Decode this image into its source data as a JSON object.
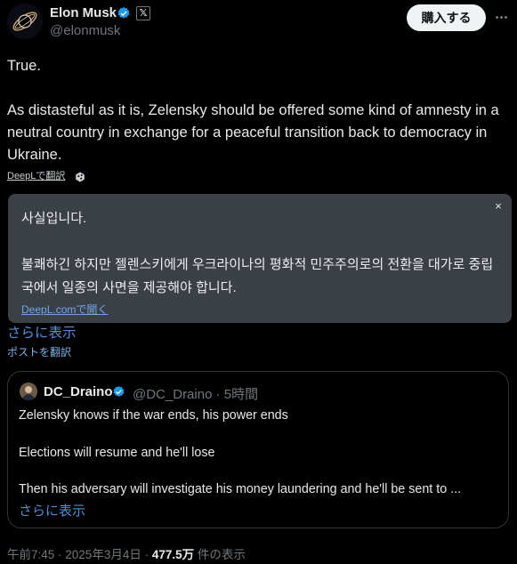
{
  "author": {
    "name": "Elon Musk",
    "handle": "@elonmusk",
    "x_badge": "𝕏"
  },
  "subscribe_button": "購入する",
  "tweet": {
    "text": "True.\n\nAs distasteful as it is, Zelensky should be offered some kind of amnesty in a neutral country in exchange for a peaceful transition back to democracy in Ukraine."
  },
  "deepl": {
    "label": "DeepLで翻訳",
    "translation": "사실입니다.\n\n불쾌하긴 하지만 젤렌스키에게 우크라이나의 평화적 민주주의로의 전환을 대가로 중립국에서 일종의 사면을 제공해야 합니다.",
    "open_link": "DeepL.comで開く",
    "close": "×"
  },
  "show_more": "さらに表示",
  "translate_post": "ポストを翻訳",
  "quote": {
    "name": "DC_Draino",
    "handle": "@DC_Draino",
    "time": "5時間",
    "text": "Zelensky knows if the war ends, his power ends\n\nElections will resume and he'll lose\n\nThen his adversary will investigate his money laundering and he'll be sent to ...",
    "show_more": "さらに表示"
  },
  "footer": {
    "time": "午前7:45",
    "date": "2025年3月4日",
    "views": "477.5万",
    "views_label": "件の表示"
  },
  "colors": {
    "background": "#000000",
    "verified": "#1d9bf0",
    "link": "#4c8fd8",
    "translation_box": "#3b4047"
  }
}
